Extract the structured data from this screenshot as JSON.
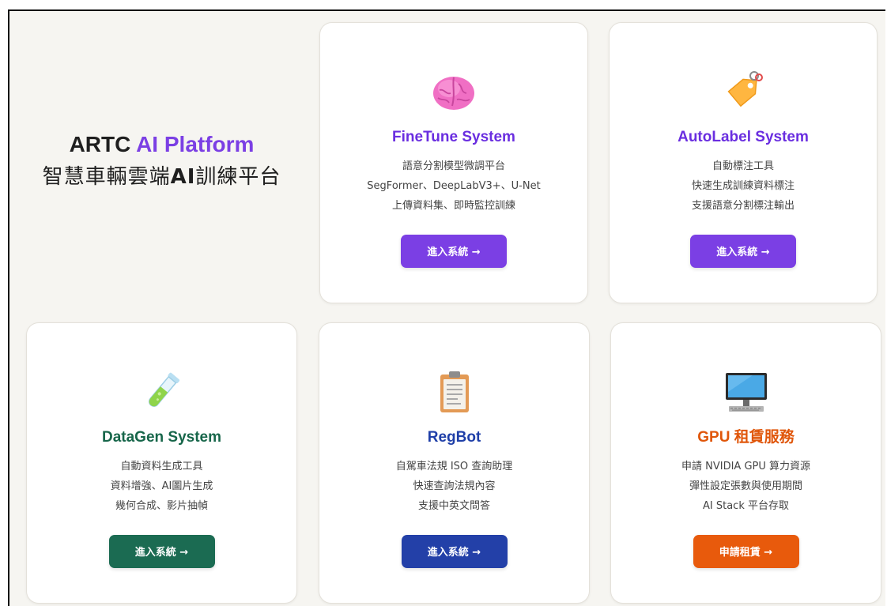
{
  "hero": {
    "title_prefix": "ARTC",
    "title_accent": "AI Platform",
    "subtitle_prefix": "智慧車輛雲端",
    "subtitle_bold": "AI",
    "subtitle_suffix": "訓練平台"
  },
  "cards": [
    {
      "id": "finetune",
      "icon": "brain-icon",
      "title": "FineTune System",
      "title_color": "#6a2ee0",
      "lines": [
        "語意分割模型微調平台",
        "SegFormer、DeepLabV3+、U-Net",
        "上傳資料集、即時監控訓練"
      ],
      "button_label": "進入系統 →",
      "button_color": "#7b3fe4"
    },
    {
      "id": "autolabel",
      "icon": "tag-icon",
      "title": "AutoLabel System",
      "title_color": "#6a2ee0",
      "lines": [
        "自動標注工具",
        "快速生成訓練資料標注",
        "支援語意分割標注輸出"
      ],
      "button_label": "進入系統 →",
      "button_color": "#7b3fe4"
    },
    {
      "id": "datagen",
      "icon": "test-tube-icon",
      "title": "DataGen System",
      "title_color": "#17664a",
      "lines": [
        "自動資料生成工具",
        "資料增強、AI圖片生成",
        "幾何合成、影片抽幀"
      ],
      "button_label": "進入系統 →",
      "button_color": "#1b6b52"
    },
    {
      "id": "regbot",
      "icon": "clipboard-icon",
      "title": "RegBot",
      "title_color": "#1f3fa8",
      "lines": [
        "自駕車法規 ISO 查詢助理",
        "快速查詢法規內容",
        "支援中英文問答"
      ],
      "button_label": "進入系統 →",
      "button_color": "#2340a8"
    },
    {
      "id": "gpu",
      "icon": "computer-monitor-icon",
      "title": "GPU 租賃服務",
      "title_color": "#e0560a",
      "lines": [
        "申請 NVIDIA GPU 算力資源",
        "彈性設定張數與使用期間",
        "AI Stack 平台存取"
      ],
      "button_label": "申請租賃 →",
      "button_color": "#e85a0c"
    }
  ]
}
